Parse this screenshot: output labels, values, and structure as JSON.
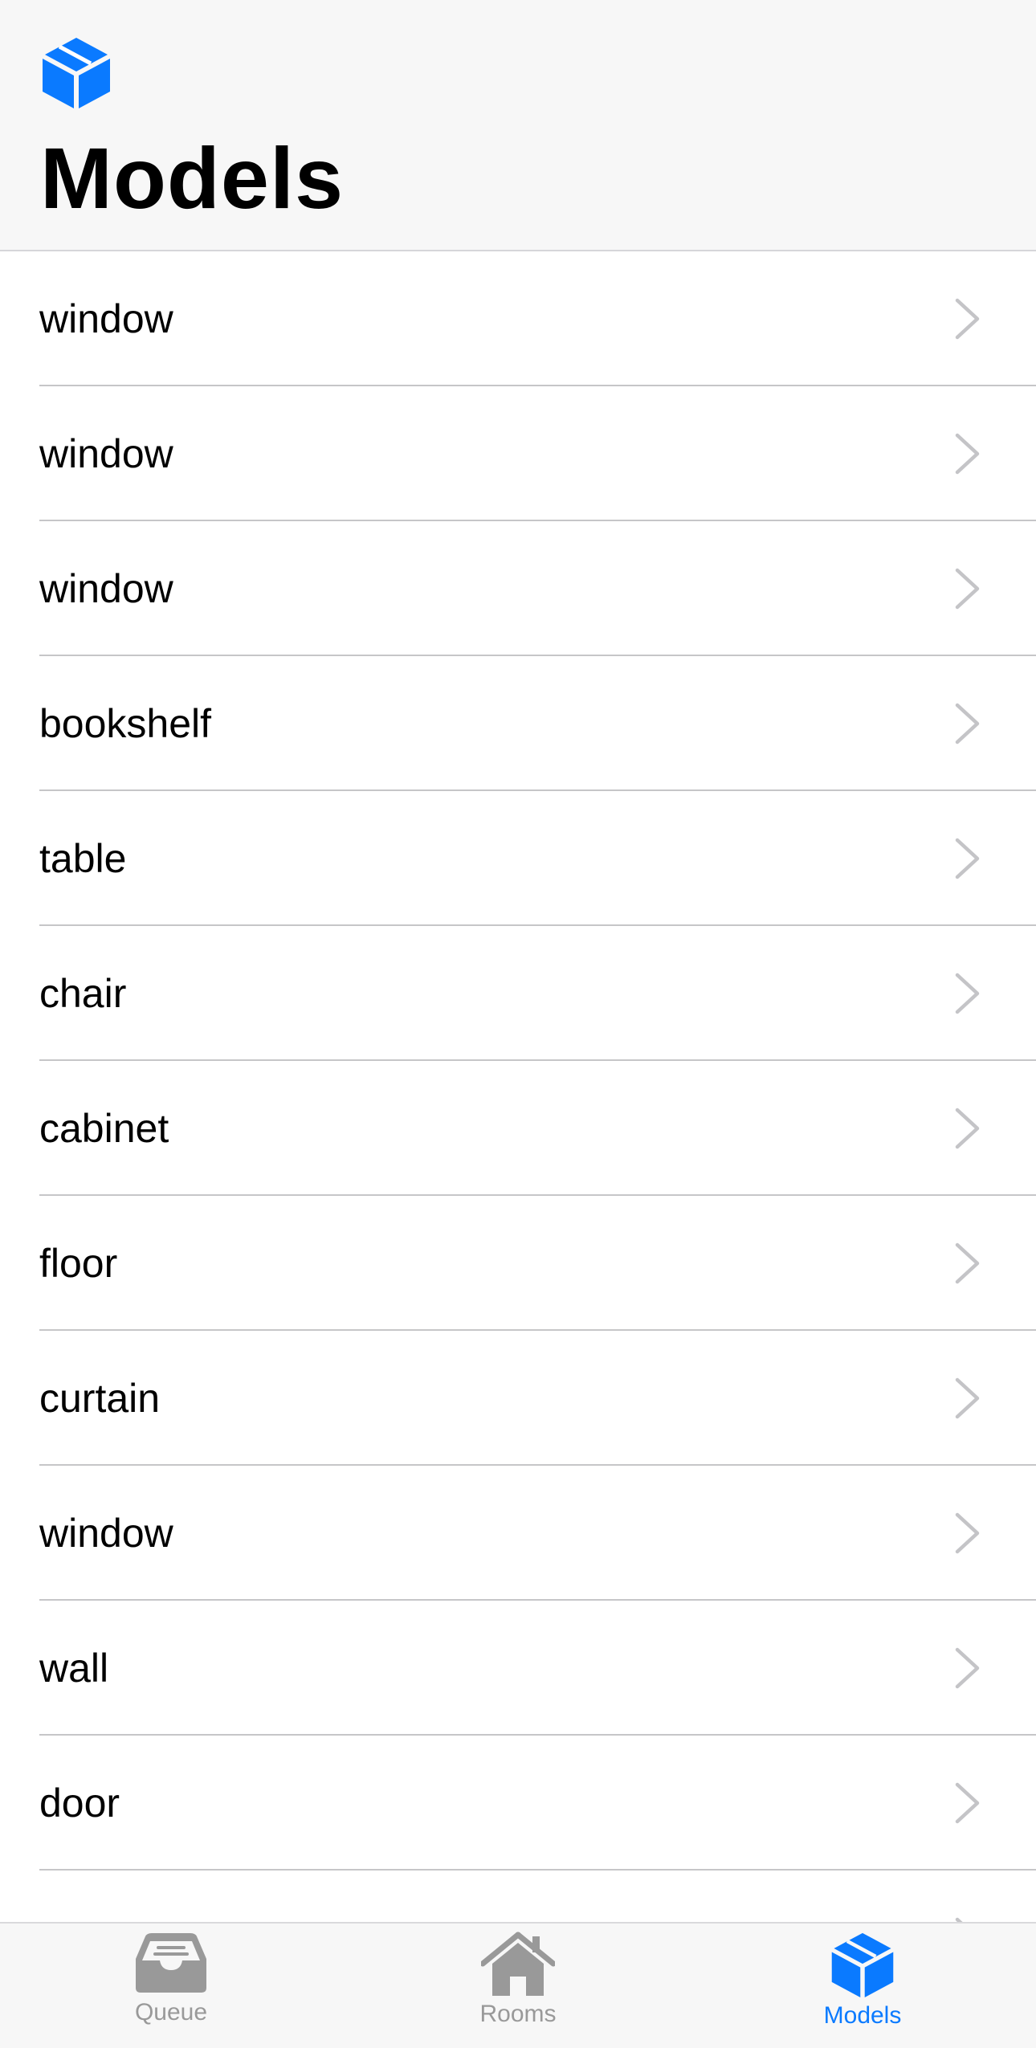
{
  "header": {
    "icon": "cube-icon",
    "title": "Models"
  },
  "list": {
    "items": [
      {
        "label": "window"
      },
      {
        "label": "window"
      },
      {
        "label": "window"
      },
      {
        "label": "bookshelf"
      },
      {
        "label": "table"
      },
      {
        "label": "chair"
      },
      {
        "label": "cabinet"
      },
      {
        "label": "floor"
      },
      {
        "label": "curtain"
      },
      {
        "label": "window"
      },
      {
        "label": "wall"
      },
      {
        "label": "door"
      },
      {
        "label": ""
      }
    ],
    "row_icon": "chevron-right-icon"
  },
  "tabbar": {
    "tabs": [
      {
        "label": "Queue",
        "icon": "tray-icon",
        "active": false
      },
      {
        "label": "Rooms",
        "icon": "house-icon",
        "active": false
      },
      {
        "label": "Models",
        "icon": "cube-icon",
        "active": true
      }
    ]
  },
  "colors": {
    "accent": "#0a7aff",
    "inactive": "#999999",
    "separator": "#c6c6c8",
    "bar_background": "#f7f7f7"
  }
}
